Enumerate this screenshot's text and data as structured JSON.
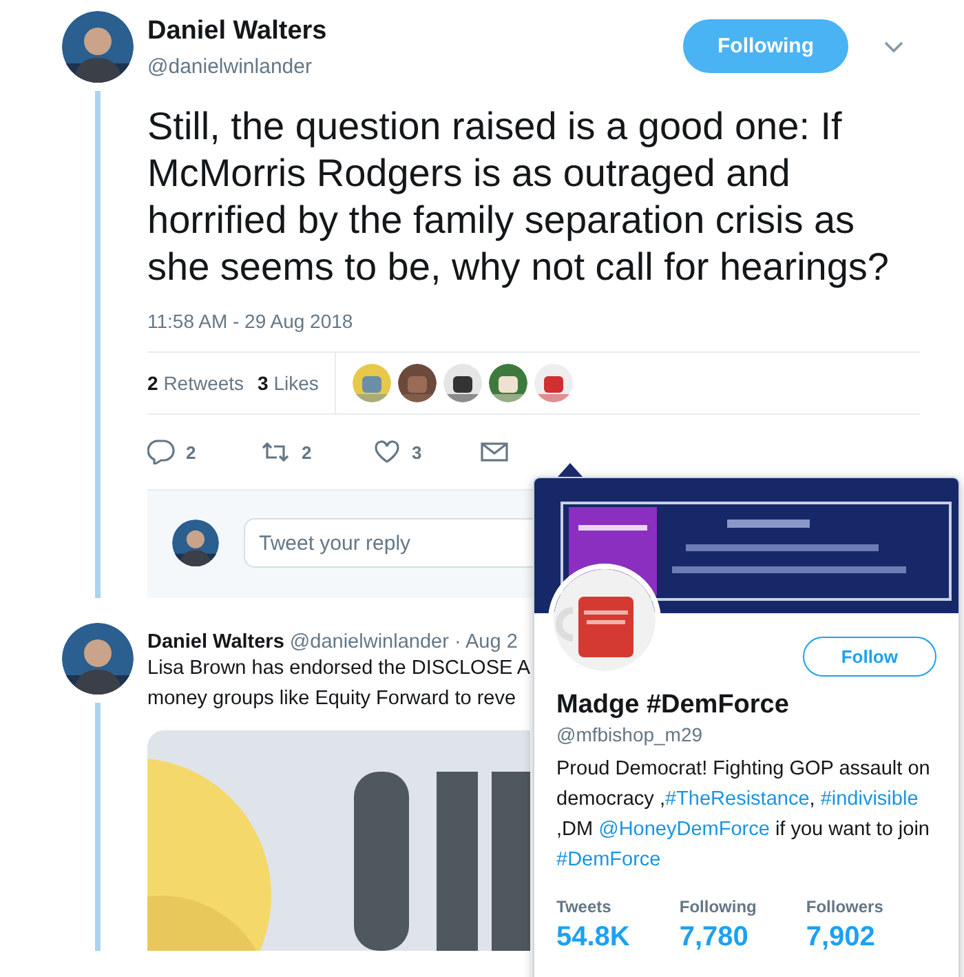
{
  "tweet": {
    "author": {
      "name": "Daniel Walters",
      "handle": "@danielwinlander"
    },
    "follow_button": {
      "label": "Following",
      "following": true
    },
    "text": "Still, the question raised is a good one: If McMorris Rodgers is as outraged and horrified by the family separation crisis as she seems to be, why not call for hearings?",
    "timestamp": "11:58 AM - 29 Aug 2018",
    "stats": [
      {
        "count": "2",
        "label": "Retweets"
      },
      {
        "count": "3",
        "label": "Likes"
      }
    ],
    "actions": [
      {
        "kind": "reply",
        "count": "2"
      },
      {
        "kind": "retweet",
        "count": "2"
      },
      {
        "kind": "like",
        "count": "3"
      },
      {
        "kind": "message"
      }
    ]
  },
  "reply_box": {
    "placeholder": "Tweet your reply"
  },
  "next_tweet": {
    "name": "Daniel Walters",
    "handle": "@danielwinlander",
    "date": "· Aug 2",
    "lines": [
      "Lisa Brown has endorsed the DISCLOSE A",
      "money groups like Equity Forward to reve"
    ]
  },
  "profile_card": {
    "follow_button": {
      "label": "Follow",
      "following": false
    },
    "name": "Madge #DemForce",
    "handle": "@mfbishop_m29",
    "bio": [
      {
        "kind": "text",
        "text": "Proud Democrat! Fighting GOP assault on democracy ,"
      },
      {
        "kind": "link",
        "text": "#TheResistance"
      },
      {
        "kind": "text",
        "text": ", "
      },
      {
        "kind": "link",
        "text": "#indivisible"
      },
      {
        "kind": "text",
        "text": " ,DM "
      },
      {
        "kind": "link",
        "text": "@HoneyDemForce"
      },
      {
        "kind": "text",
        "text": " if you want to join "
      },
      {
        "kind": "link",
        "text": "#DemForce"
      }
    ],
    "stats": [
      {
        "label": "Tweets",
        "value": "54.8K"
      },
      {
        "label": "Following",
        "value": "7,780"
      },
      {
        "label": "Followers",
        "value": "7,902"
      }
    ]
  }
}
